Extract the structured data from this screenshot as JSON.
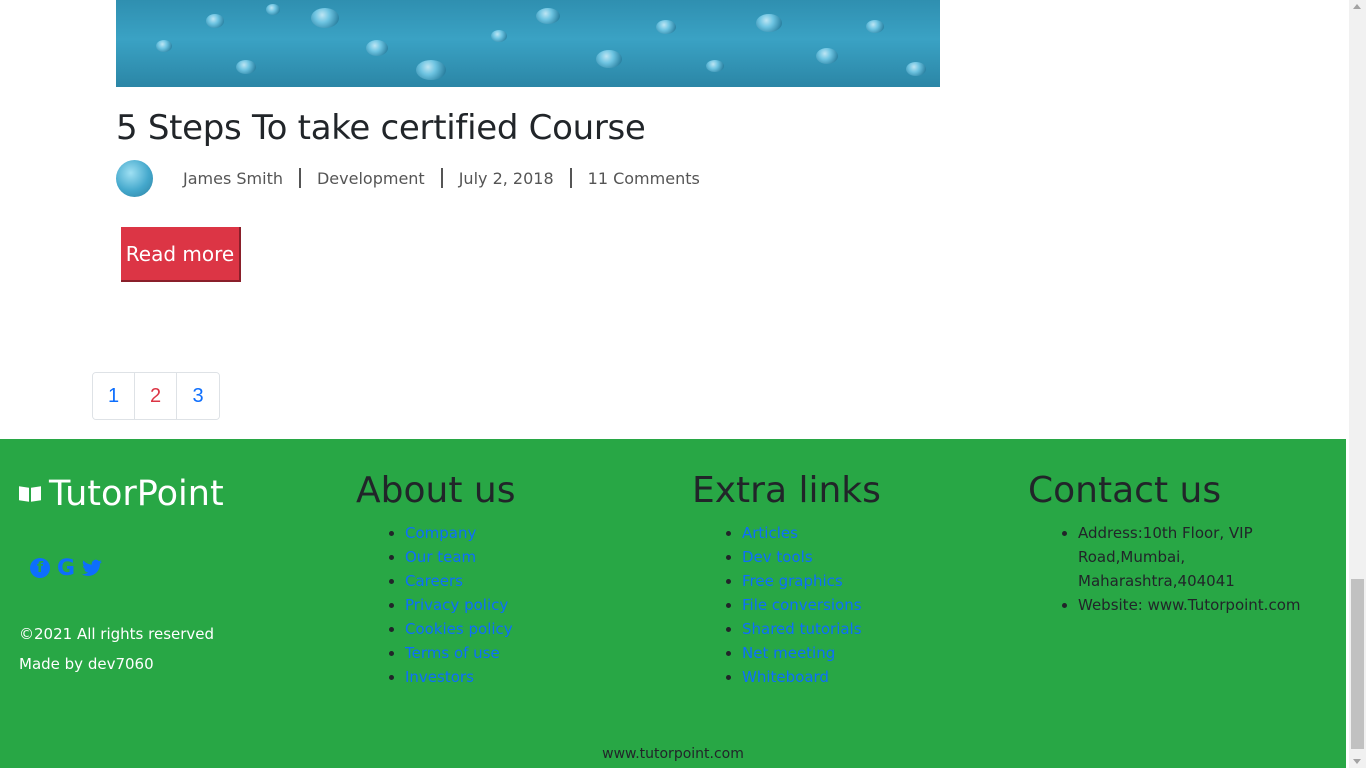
{
  "post": {
    "title": "5 Steps To take certified Course",
    "author": "James Smith",
    "category": "Development",
    "date": "July 2, 2018",
    "comments": "11 Comments",
    "read_more": "Read more"
  },
  "pagination": {
    "pages": [
      "1",
      "2",
      "3"
    ],
    "active": "2"
  },
  "footer": {
    "brand": "TutorPoint",
    "social_icons": [
      "facebook-icon",
      "google-icon",
      "twitter-icon"
    ],
    "copyright": "©2021 All rights reserved",
    "made_by": "Made by dev7060",
    "about": {
      "heading": "About us",
      "links": [
        "Company",
        "Our team",
        "Careers",
        "Privacy policy",
        "Cookies policy",
        "Terms of use",
        "Investors"
      ]
    },
    "extra": {
      "heading": "Extra links",
      "links": [
        "Articles",
        "Dev tools",
        "Free graphics",
        "File conversions",
        "Shared tutorials",
        "Net meeting",
        "Whiteboard"
      ]
    },
    "contact": {
      "heading": "Contact us",
      "items": [
        "Address:10th Floor, VIP Road,Mumbai, Maharashtra,404041",
        "Website: www.Tutorpoint.com"
      ]
    },
    "bottom_url": "www.tutorpoint.com"
  },
  "colors": {
    "footer_bg": "#28a745",
    "button_bg": "#dc3545",
    "link": "#0d6efd"
  }
}
